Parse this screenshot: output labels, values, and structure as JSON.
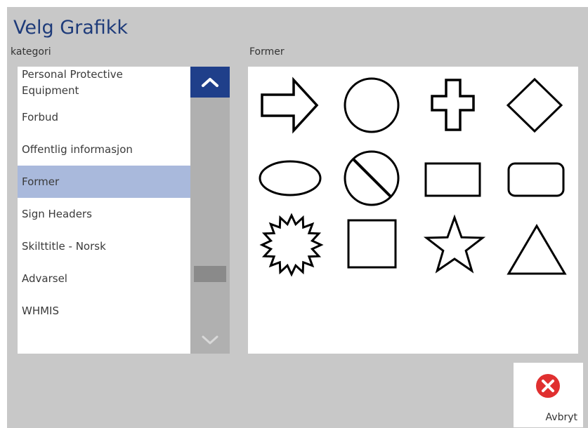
{
  "dialog": {
    "title": "Velg Grafikk",
    "category_label": "kategori",
    "shapes_label": "Former"
  },
  "categories": [
    {
      "label": "Personal Protective Equipment",
      "selected": false
    },
    {
      "label": "Forbud",
      "selected": false
    },
    {
      "label": "Offentlig informasjon",
      "selected": false
    },
    {
      "label": "Former",
      "selected": true
    },
    {
      "label": "Sign Headers",
      "selected": false
    },
    {
      "label": "Skilttitle - Norsk",
      "selected": false
    },
    {
      "label": "Advarsel",
      "selected": false
    },
    {
      "label": "WHMIS",
      "selected": false
    }
  ],
  "shapes": [
    {
      "icon": "arrow-right-icon"
    },
    {
      "icon": "circle-icon"
    },
    {
      "icon": "cross-icon"
    },
    {
      "icon": "diamond-icon"
    },
    {
      "icon": "ellipse-icon"
    },
    {
      "icon": "prohibition-icon"
    },
    {
      "icon": "rectangle-icon"
    },
    {
      "icon": "rounded-rectangle-icon"
    },
    {
      "icon": "starburst-icon"
    },
    {
      "icon": "square-icon"
    },
    {
      "icon": "star-icon"
    },
    {
      "icon": "triangle-icon"
    }
  ],
  "scrollbar": {
    "up_icon": "chevron-up-icon",
    "down_icon": "chevron-down-icon",
    "accent_color": "#1f3f8a"
  },
  "actions": {
    "cancel_label": "Avbryt",
    "cancel_icon": "close-circle-icon",
    "cancel_color": "#e03030"
  },
  "colors": {
    "title": "#1e3b7a",
    "selected_row": "#a9b9dc",
    "background": "#c8c8c8"
  }
}
